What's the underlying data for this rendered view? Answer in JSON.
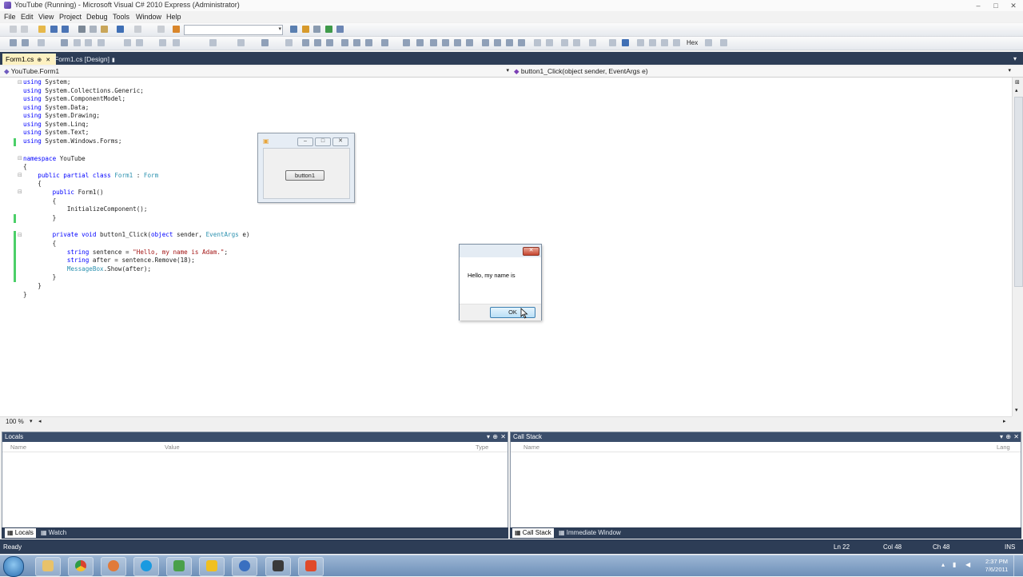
{
  "window": {
    "title": "YouTube (Running) - Microsoft Visual C# 2010 Express (Administrator)",
    "min": "–",
    "max": "□",
    "close": "✕"
  },
  "menu": [
    "File",
    "Edit",
    "View",
    "Project",
    "Debug",
    "Tools",
    "Window",
    "Help"
  ],
  "toolbar": {
    "hex_label": "Hex"
  },
  "tabs": {
    "tab1": "Form1.cs",
    "tab2": "Form1.cs [Design]"
  },
  "navbar": {
    "left": "YouTube.Form1",
    "right": "button1_Click(object sender, EventArgs e)"
  },
  "code": {
    "l1": [
      "using",
      " System;"
    ],
    "l2": [
      "using",
      " System.Collections.Generic;"
    ],
    "l3": [
      "using",
      " System.ComponentModel;"
    ],
    "l4": [
      "using",
      " System.Data;"
    ],
    "l5": [
      "using",
      " System.Drawing;"
    ],
    "l6": [
      "using",
      " System.Linq;"
    ],
    "l7": [
      "using",
      " System.Text;"
    ],
    "l8": [
      "using",
      " System.Windows.Forms;"
    ],
    "l9a": "namespace",
    "l9b": " YouTube",
    "l10": "{",
    "l11a": "    public partial class",
    "l11b": "Form1",
    "l11c": " : ",
    "l11d": "Form",
    "l12": "    {",
    "l13a": "        public",
    "l13b": " Form1()",
    "l14": "        {",
    "l15": "            InitializeComponent();",
    "l16": "        }",
    "l17a": "        private void",
    "l17b": " button1_Click(",
    "l17c": "object",
    "l17d": " sender, ",
    "l17e": "EventArgs",
    "l17f": " e)",
    "l18": "        {",
    "l19a": "            string",
    "l19b": " sentence = ",
    "l19c": "\"Hello, my name is Adam.\"",
    "l19d": ";",
    "l20a": "            string",
    "l20b": " after = sentence.Remove(18);",
    "l21a": "MessageBox",
    "l21b": ".Show(after);",
    "l22": "        }",
    "l23": "    }",
    "l24": "}"
  },
  "zoom": "100 %",
  "designer": {
    "button_label": "button1"
  },
  "msgbox": {
    "text": "Hello, my name is",
    "ok": "OK",
    "close": "✕"
  },
  "locals": {
    "title": "Locals",
    "col_name": "Name",
    "col_value": "Value",
    "col_type": "Type"
  },
  "callstack": {
    "title": "Call Stack",
    "col_name": "Name",
    "col_lang": "Lang"
  },
  "pane_tabs": {
    "locals": "Locals",
    "watch": "Watch",
    "callstack": "Call Stack",
    "immediate": "Immediate Window"
  },
  "status": {
    "ready": "Ready",
    "ln": "Ln 22",
    "col": "Col 48",
    "ch": "Ch 48",
    "ins": "INS"
  },
  "clock": {
    "time": "2:37 PM",
    "date": "7/6/2011"
  },
  "colors": {
    "accent": "#2d3d56",
    "tab_active": "#fdf1c2",
    "change_bar": "#4bcf68"
  }
}
